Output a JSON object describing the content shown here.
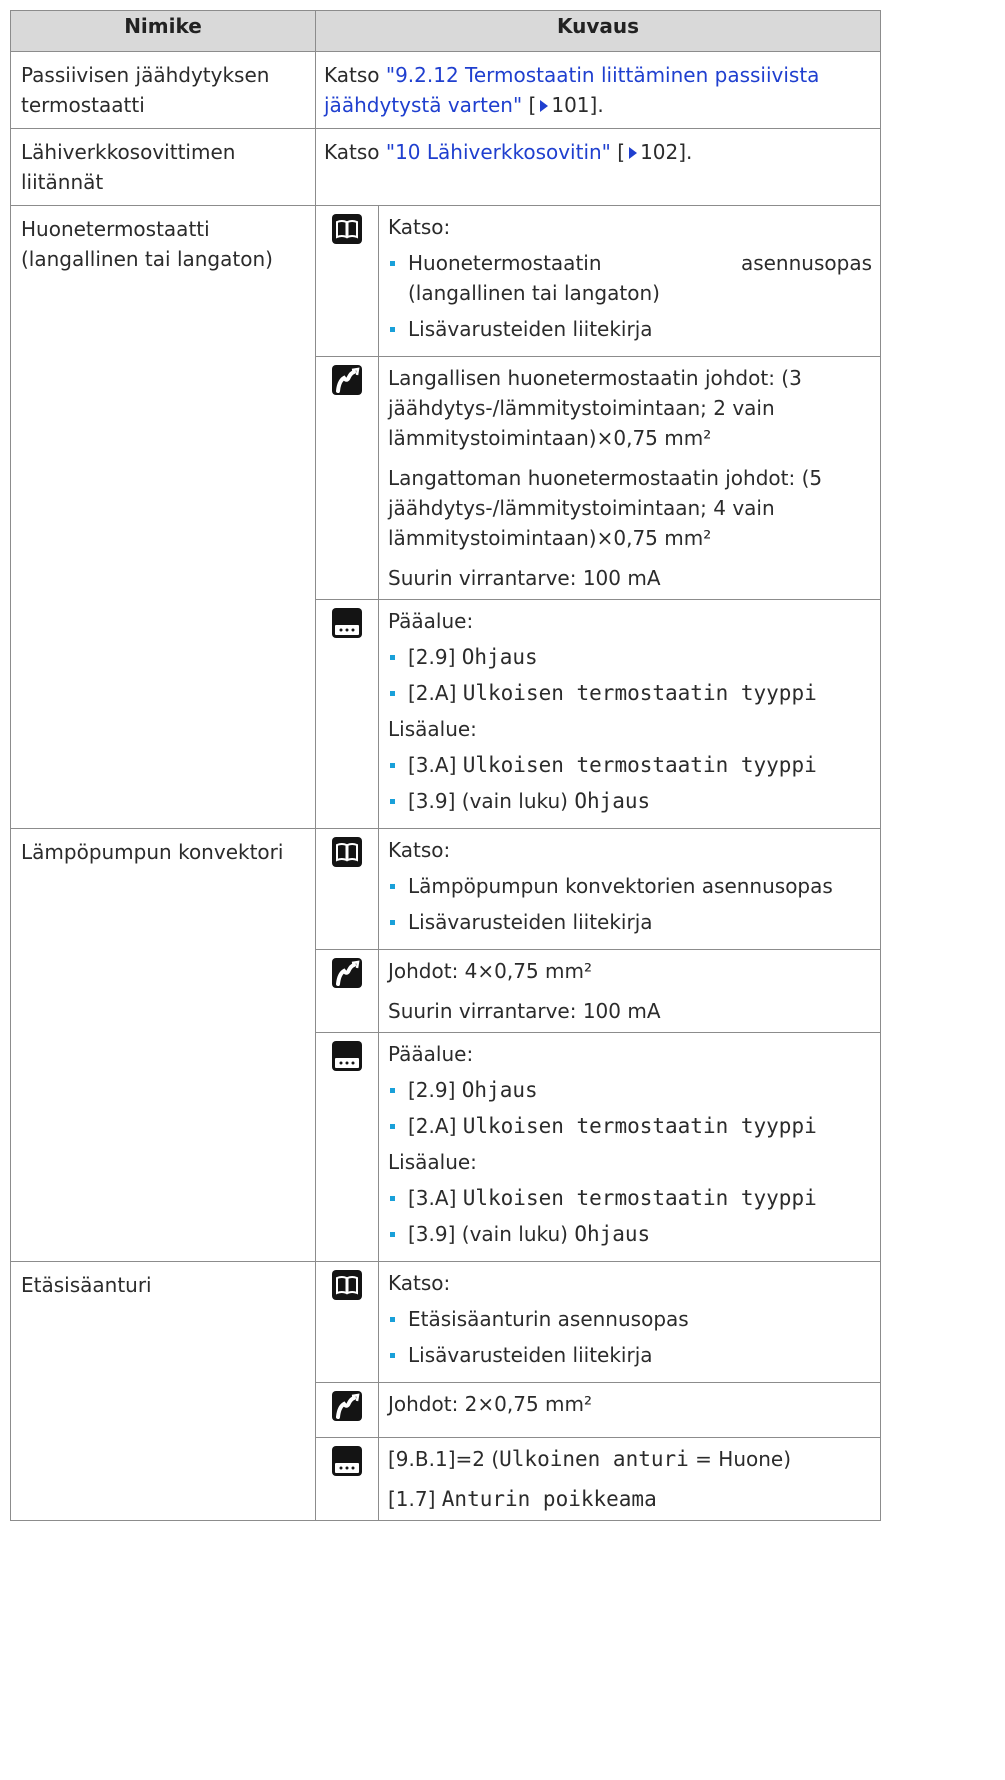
{
  "header": {
    "col1": "Nimike",
    "col2": "Kuvaus"
  },
  "rows": {
    "passive": {
      "name": "Passiivisen jäähdytyksen termostaatti",
      "text_pre": "Katso ",
      "link": "\"9.2.12 Termostaatin liittäminen passiivista jäähdytystä varten\"",
      "ref_open": " [",
      "page": "101",
      "ref_close": "]."
    },
    "lan": {
      "name": "Lähiverkkosovittimen liitännät",
      "text_pre": "Katso ",
      "link": "\"10 Lähiverkkosovitin\"",
      "ref_open": " [",
      "page": "102",
      "ref_close": "]."
    },
    "room": {
      "name": "Huonetermostaatti (langallinen tai langaton)",
      "book": {
        "title": "Katso:",
        "b1a": "Huonetermostaatin",
        "b1b": "asennusopas",
        "b1c": "(langallinen tai langaton)",
        "b2": "Lisävarusteiden liitekirja"
      },
      "wiring": {
        "p1": "Langallisen huonetermostaatin johdot: (3 jäähdytys-/lämmitystoimintaan; 2 vain lämmitystoimintaan)×0,75 mm²",
        "p2": "Langattoman huonetermostaatin johdot: (5 jäähdytys-/lämmitystoimintaan; 4 vain lämmitystoimintaan)×0,75 mm²",
        "p3": "Suurin virrantarve: 100 mA"
      },
      "ui": {
        "main": "Pääalue:",
        "m1code": "[2.9]",
        "m1val": "Ohjaus",
        "m2code": "[2.A]",
        "m2val": "Ulkoisen termostaatin tyyppi",
        "add": "Lisäalue:",
        "a1code": "[3.A]",
        "a1val": "Ulkoisen termostaatin tyyppi",
        "a2code": "[3.9]",
        "a2note": "(vain luku)",
        "a2val": "Ohjaus"
      }
    },
    "convector": {
      "name": "Lämpöpumpun konvektori",
      "book": {
        "title": "Katso:",
        "b1": "Lämpöpumpun konvektorien asennusopas",
        "b2": "Lisävarusteiden liitekirja"
      },
      "wiring": {
        "p1": "Johdot: 4×0,75 mm²",
        "p2": "Suurin virrantarve: 100 mA"
      },
      "ui": {
        "main": "Pääalue:",
        "m1code": "[2.9]",
        "m1val": "Ohjaus",
        "m2code": "[2.A]",
        "m2val": "Ulkoisen termostaatin tyyppi",
        "add": "Lisäalue:",
        "a1code": "[3.A]",
        "a1val": "Ulkoisen termostaatin tyyppi",
        "a2code": "[3.9]",
        "a2note": "(vain luku)",
        "a2val": "Ohjaus"
      }
    },
    "sensor": {
      "name": "Etäsisäanturi",
      "book": {
        "title": "Katso:",
        "b1": "Etäsisäanturin asennusopas",
        "b2": "Lisävarusteiden liitekirja"
      },
      "wiring": {
        "p1": "Johdot: 2×0,75 mm²"
      },
      "ui": {
        "l1code": "[9.B.1]=2 (",
        "l1val": "Ulkoinen anturi",
        "l1eq": " = ",
        "l1val2": "Huone",
        "l1close": ")",
        "l2code": "[1.7]",
        "l2val": "Anturin poikkeama"
      }
    }
  },
  "icons": {
    "book": "manual-book-icon",
    "wire": "wiring-icon",
    "ui": "user-interface-icon"
  }
}
